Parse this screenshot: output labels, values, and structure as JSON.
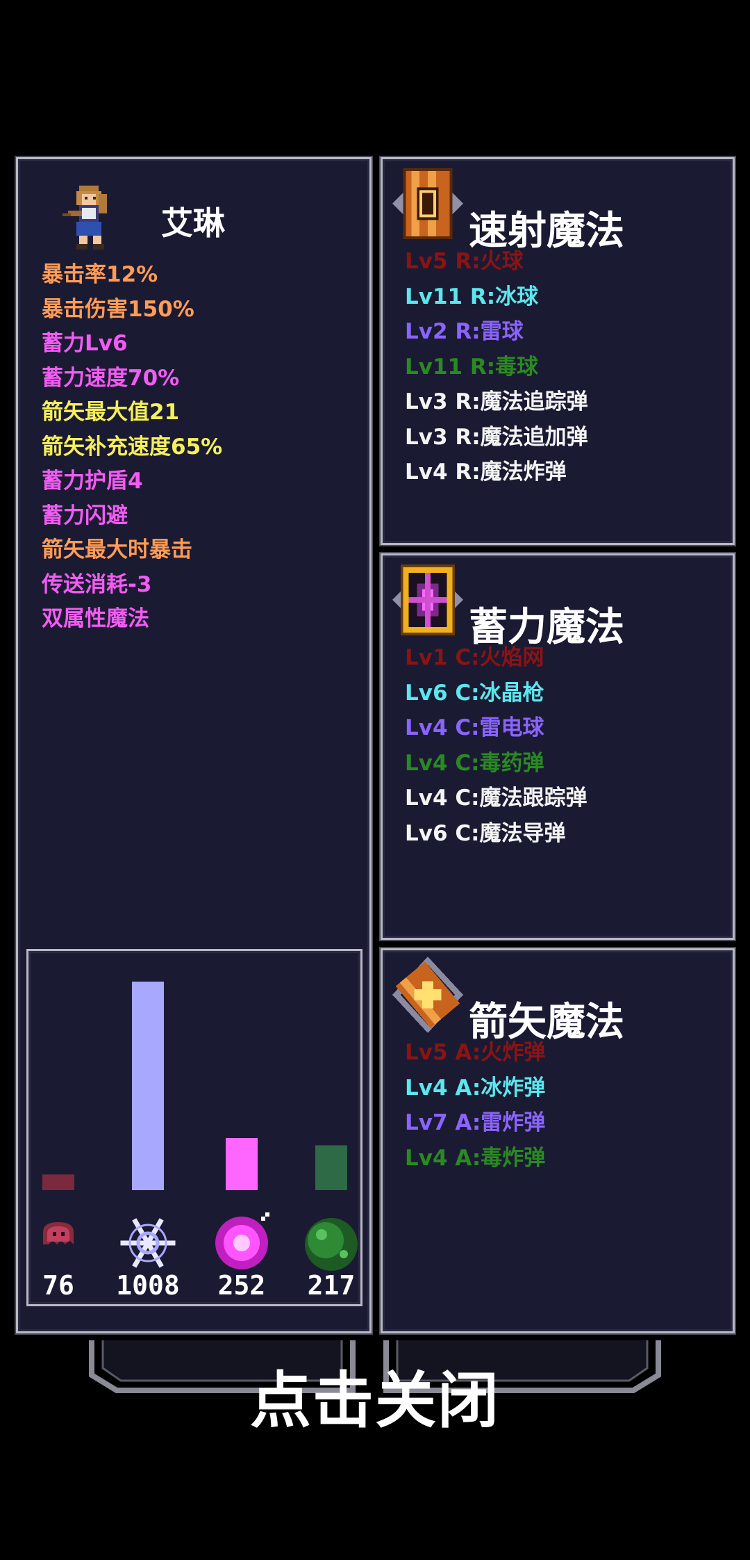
{
  "character": {
    "name": "艾琳",
    "stats": [
      {
        "text": "暴击率12%",
        "color": "#ff9c56"
      },
      {
        "text": "暴击伤害150%",
        "color": "#ff9c56"
      },
      {
        "text": "蓄力Lv6",
        "color": "#f25cf2"
      },
      {
        "text": "蓄力速度70%",
        "color": "#f25cf2"
      },
      {
        "text": "箭矢最大值21",
        "color": "#f5f05a"
      },
      {
        "text": "箭矢补充速度65%",
        "color": "#f5f05a"
      },
      {
        "text": "蓄力护盾4",
        "color": "#f25cf2"
      },
      {
        "text": "蓄力闪避",
        "color": "#f25cf2"
      },
      {
        "text": "箭矢最大时暴击",
        "color": "#ff9c56"
      },
      {
        "text": "传送消耗-3",
        "color": "#f25cf2"
      },
      {
        "text": "双属性魔法",
        "color": "#f25cf2"
      }
    ]
  },
  "chart_data": {
    "type": "bar",
    "categories": [
      "fire",
      "ice",
      "thunder",
      "poison"
    ],
    "values": [
      76,
      1008,
      252,
      217
    ],
    "value_labels": [
      "76",
      "1008",
      "252",
      "217"
    ],
    "colors": [
      "#7a2a3c",
      "#a8a8ff",
      "#ff66ff",
      "#2e6a45"
    ],
    "ylim": [
      0,
      1008
    ]
  },
  "sections": {
    "rapid": {
      "title": "速射魔法",
      "icon": "rapid-magic-scroll-icon",
      "spells": [
        {
          "text": "Lv5 R:火球",
          "color": "#8a1414"
        },
        {
          "text": "Lv11 R:冰球",
          "color": "#5ce6ee"
        },
        {
          "text": "Lv2 R:雷球",
          "color": "#8a64ff"
        },
        {
          "text": "Lv11 R:毒球",
          "color": "#2a8a22"
        },
        {
          "text": "Lv3 R:魔法追踪弹",
          "color": "#f4f4f4"
        },
        {
          "text": "Lv3 R:魔法追加弹",
          "color": "#f4f4f4"
        },
        {
          "text": "Lv4 R:魔法炸弹",
          "color": "#f4f4f4"
        }
      ]
    },
    "charge": {
      "title": "蓄力魔法",
      "icon": "charge-magic-sigil-icon",
      "spells": [
        {
          "text": "Lv1 C:火焰网",
          "color": "#8a1414"
        },
        {
          "text": "Lv6 C:冰晶枪",
          "color": "#5ce6ee"
        },
        {
          "text": "Lv4 C:雷电球",
          "color": "#8a64ff"
        },
        {
          "text": "Lv4 C:毒药弹",
          "color": "#2a8a22"
        },
        {
          "text": "Lv4 C:魔法跟踪弹",
          "color": "#f4f4f4"
        },
        {
          "text": "Lv6 C:魔法导弹",
          "color": "#f4f4f4"
        }
      ]
    },
    "arrow": {
      "title": "箭矢魔法",
      "icon": "arrow-magic-scroll-icon",
      "spells": [
        {
          "text": "Lv5 A:火炸弹",
          "color": "#8a1414"
        },
        {
          "text": "Lv4 A:冰炸弹",
          "color": "#5ce6ee"
        },
        {
          "text": "Lv7 A:雷炸弹",
          "color": "#8a64ff"
        },
        {
          "text": "Lv4 A:毒炸弹",
          "color": "#2a8a22"
        }
      ]
    }
  },
  "close_label": "点击关闭",
  "chart_icons": [
    "fire-ghost-icon",
    "ice-snowflake-icon",
    "thunder-orb-icon",
    "poison-blob-icon"
  ]
}
